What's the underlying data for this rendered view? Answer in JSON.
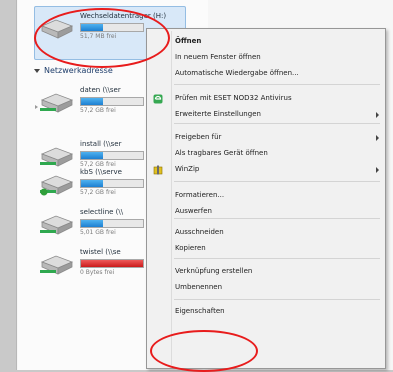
{
  "drives": [
    {
      "name": "Wechseldatenträger (H:)",
      "free": "51,7 MB frei",
      "fill": 0.35,
      "color": "#1d7fd1"
    },
    {
      "name": "daten (\\\\ser",
      "free": "57,2 GB frei",
      "fill": 0.35,
      "color": "#1d7fd1"
    },
    {
      "name": "install (\\\\ser",
      "free": "57,2 GB frei",
      "fill": 0.35,
      "color": "#1d7fd1"
    },
    {
      "name": "kbS (\\\\serve",
      "free": "57,2 GB frei",
      "fill": 0.35,
      "color": "#1d7fd1"
    },
    {
      "name": "selectline (\\\\",
      "free": "5,01 GB frei",
      "fill": 0.35,
      "color": "#1d7fd1"
    },
    {
      "name": "twistel (\\\\se",
      "free": "0 Bytes frei",
      "fill": 1.0,
      "color": "#cb1a1a"
    }
  ],
  "section_label": "Netzwerkadresse",
  "menu": {
    "items": [
      {
        "label": "Öffnen",
        "bold": true
      },
      {
        "label": "In neuem Fenster öffnen"
      },
      {
        "label": "Automatische Wiedergabe öffnen..."
      },
      {
        "label": "Prüfen mit ESET NOD32 Antivirus",
        "icon": "eset-icon"
      },
      {
        "label": "Erweiterte Einstellungen",
        "submenu": true
      },
      {
        "label": "Freigeben für",
        "submenu": true
      },
      {
        "label": "Als tragbares Gerät öffnen"
      },
      {
        "label": "WinZip",
        "submenu": true,
        "icon": "winzip-icon"
      },
      {
        "label": "Formatieren..."
      },
      {
        "label": "Auswerfen"
      },
      {
        "label": "Ausschneiden"
      },
      {
        "label": "Kopieren"
      },
      {
        "label": "Verknüpfung erstellen"
      },
      {
        "label": "Umbenennen"
      },
      {
        "label": "Eigenschaften"
      }
    ]
  }
}
